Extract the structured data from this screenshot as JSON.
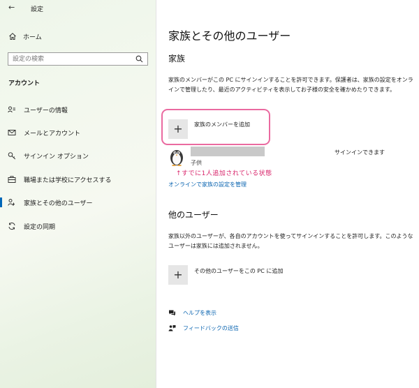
{
  "app": {
    "title": "設定",
    "back_icon": "back-arrow-icon"
  },
  "sidebar": {
    "home_label": "ホーム",
    "search_placeholder": "設定の検索",
    "section_title": "アカウント",
    "items": [
      {
        "label": "ユーザーの情報",
        "icon": "user-info-icon",
        "active": false
      },
      {
        "label": "メールとアカウント",
        "icon": "mail-icon",
        "active": false
      },
      {
        "label": "サインイン オプション",
        "icon": "key-icon",
        "active": false
      },
      {
        "label": "職場または学校にアクセスする",
        "icon": "briefcase-icon",
        "active": false
      },
      {
        "label": "家族とその他のユーザー",
        "icon": "family-icon",
        "active": true
      },
      {
        "label": "設定の同期",
        "icon": "sync-icon",
        "active": false
      }
    ],
    "active_color": "#0067b8"
  },
  "main": {
    "title": "家族とその他のユーザー",
    "family": {
      "heading": "家族",
      "description": "家族のメンバーがこの PC にサインインすることを許可できます。保護者は、家族の設定をオンラインで管理したり、最近のアクティビティを表示してお子様の安全を確かめたりできます。",
      "add_label": "家族のメンバーを追加",
      "member": {
        "role": "子供",
        "status": "サインインできます"
      },
      "annotation": "↑すでに1人追加されている状態",
      "manage_link": "オンラインで家族の設定を管理"
    },
    "other": {
      "heading": "他のユーザー",
      "description": "家族以外のユーザーが、各自のアカウントを使ってサインインすることを許可します。このようなユーザーは家族には追加されません。",
      "add_label": "その他のユーザーをこの PC に追加"
    },
    "help_label": "ヘルプを表示",
    "feedback_label": "フィードバックの送信",
    "link_color": "#0a64b0",
    "highlight_color": "#ea6aa0",
    "annotation_color": "#d8246a"
  }
}
